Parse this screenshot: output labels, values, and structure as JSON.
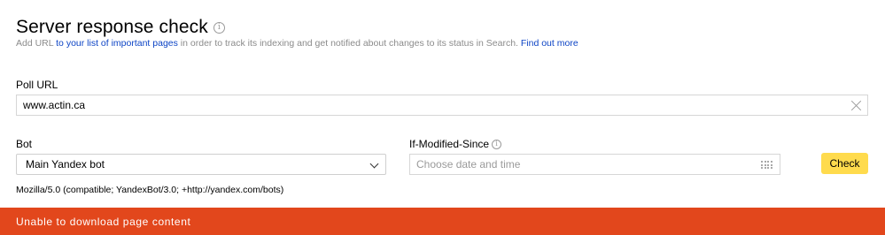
{
  "header": {
    "title": "Server response check",
    "info_icon": "info-icon",
    "subtitle_prefix": "Add URL ",
    "subtitle_link1": "to your list of important pages",
    "subtitle_middle": " in order to track its indexing and get notified about changes to its status in Search. ",
    "subtitle_link2": "Find out more"
  },
  "form": {
    "poll_url_label": "Poll URL",
    "poll_url_value": "www.actin.ca",
    "bot_label": "Bot",
    "bot_selected": "Main Yandex bot",
    "if_modified_label": "If-Modified-Since",
    "date_placeholder": "Choose date and time",
    "check_button": "Check",
    "user_agent": "Mozilla/5.0 (compatible; YandexBot/3.0; +http://yandex.com/bots)"
  },
  "status": {
    "error_message": "Unable to download page content",
    "error_color": "#e2471c"
  },
  "colors": {
    "accent_button": "#ffdb4d",
    "link": "#0d44c5"
  }
}
